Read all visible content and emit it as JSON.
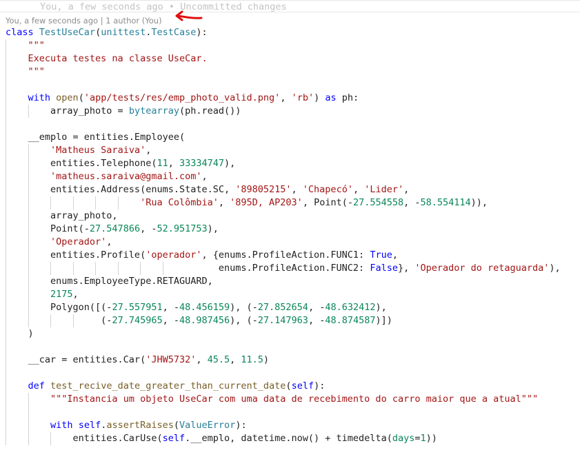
{
  "blame_ghost": "You, a few seconds ago • Uncommitted changes",
  "codelens": "You, a few seconds ago | 1 author (You)",
  "lines": [
    {
      "guides": [],
      "tokens": [
        [
          "kw",
          "class"
        ],
        [
          "t",
          " "
        ],
        [
          "cls",
          "TestUseCar"
        ],
        [
          "t",
          "("
        ],
        [
          "cls",
          "unittest"
        ],
        [
          "t",
          "."
        ],
        [
          "cls",
          "TestCase"
        ],
        [
          "t",
          "):"
        ]
      ]
    },
    {
      "guides": [
        0
      ],
      "tokens": [
        [
          "t",
          "    "
        ],
        [
          "str",
          "\"\"\""
        ]
      ]
    },
    {
      "guides": [
        0
      ],
      "tokens": [
        [
          "t",
          "    "
        ],
        [
          "str",
          "Executa testes na classe UseCar."
        ]
      ]
    },
    {
      "guides": [
        0
      ],
      "tokens": [
        [
          "t",
          "    "
        ],
        [
          "str",
          "\"\"\""
        ]
      ]
    },
    {
      "guides": [
        0
      ],
      "tokens": []
    },
    {
      "guides": [
        0
      ],
      "tokens": [
        [
          "t",
          "    "
        ],
        [
          "kw",
          "with"
        ],
        [
          "t",
          " "
        ],
        [
          "fn",
          "open"
        ],
        [
          "t",
          "("
        ],
        [
          "str",
          "'app/tests/res/emp_photo_valid.png'"
        ],
        [
          "t",
          ", "
        ],
        [
          "str",
          "'rb'"
        ],
        [
          "t",
          ") "
        ],
        [
          "kw",
          "as"
        ],
        [
          "t",
          " ph:"
        ]
      ]
    },
    {
      "guides": [
        0,
        4
      ],
      "tokens": [
        [
          "t",
          "        array_photo = "
        ],
        [
          "cls",
          "bytearray"
        ],
        [
          "t",
          "(ph.read())"
        ]
      ]
    },
    {
      "guides": [
        0
      ],
      "tokens": []
    },
    {
      "guides": [
        0
      ],
      "tokens": [
        [
          "t",
          "    __emplo = entities.Employee("
        ]
      ]
    },
    {
      "guides": [
        0,
        4
      ],
      "tokens": [
        [
          "t",
          "        "
        ],
        [
          "str",
          "'Matheus Saraiva'"
        ],
        [
          "t",
          ","
        ]
      ]
    },
    {
      "guides": [
        0,
        4
      ],
      "tokens": [
        [
          "t",
          "        entities.Telephone("
        ],
        [
          "num",
          "11"
        ],
        [
          "t",
          ", "
        ],
        [
          "num",
          "33334747"
        ],
        [
          "t",
          "),"
        ]
      ]
    },
    {
      "guides": [
        0,
        4
      ],
      "tokens": [
        [
          "t",
          "        "
        ],
        [
          "str",
          "'matheus.saraiva@gmail.com'"
        ],
        [
          "t",
          ","
        ]
      ]
    },
    {
      "guides": [
        0,
        4
      ],
      "tokens": [
        [
          "t",
          "        entities.Address(enums.State.SC, "
        ],
        [
          "str",
          "'89805215'"
        ],
        [
          "t",
          ", "
        ],
        [
          "str",
          "'Chapecó'"
        ],
        [
          "t",
          ", "
        ],
        [
          "str",
          "'Lider'"
        ],
        [
          "t",
          ","
        ]
      ]
    },
    {
      "guides": [
        0,
        4,
        8,
        12,
        16,
        20
      ],
      "tokens": [
        [
          "t",
          "                        "
        ],
        [
          "str",
          "'Rua Colômbia'"
        ],
        [
          "t",
          ", "
        ],
        [
          "str",
          "'895D, AP203'"
        ],
        [
          "t",
          ", Point(-"
        ],
        [
          "num",
          "27.554558"
        ],
        [
          "t",
          ", -"
        ],
        [
          "num",
          "58.554114"
        ],
        [
          "t",
          ")),"
        ]
      ]
    },
    {
      "guides": [
        0,
        4
      ],
      "tokens": [
        [
          "t",
          "        array_photo,"
        ]
      ]
    },
    {
      "guides": [
        0,
        4
      ],
      "tokens": [
        [
          "t",
          "        Point(-"
        ],
        [
          "num",
          "27.547866"
        ],
        [
          "t",
          ", -"
        ],
        [
          "num",
          "52.951753"
        ],
        [
          "t",
          "),"
        ]
      ]
    },
    {
      "guides": [
        0,
        4
      ],
      "tokens": [
        [
          "t",
          "        "
        ],
        [
          "str",
          "'Operador'"
        ],
        [
          "t",
          ","
        ]
      ]
    },
    {
      "guides": [
        0,
        4
      ],
      "tokens": [
        [
          "t",
          "        entities.Profile("
        ],
        [
          "str",
          "'operador'"
        ],
        [
          "t",
          ", {enums.ProfileAction.FUNC1: "
        ],
        [
          "kw",
          "True"
        ],
        [
          "t",
          ","
        ]
      ]
    },
    {
      "guides": [
        0,
        4,
        8,
        12,
        16,
        20,
        24,
        28
      ],
      "tokens": [
        [
          "t",
          "                                      enums.ProfileAction.FUNC2: "
        ],
        [
          "kw",
          "False"
        ],
        [
          "t",
          "}, "
        ],
        [
          "str",
          "'Operador do retaguarda'"
        ],
        [
          "t",
          "),"
        ]
      ]
    },
    {
      "guides": [
        0,
        4
      ],
      "tokens": [
        [
          "t",
          "        enums.EmployeeType.RETAGUARD,"
        ]
      ]
    },
    {
      "guides": [
        0,
        4
      ],
      "tokens": [
        [
          "t",
          "        "
        ],
        [
          "num",
          "2175"
        ],
        [
          "t",
          ","
        ]
      ]
    },
    {
      "guides": [
        0,
        4
      ],
      "tokens": [
        [
          "t",
          "        Polygon([(-"
        ],
        [
          "num",
          "27.557951"
        ],
        [
          "t",
          ", -"
        ],
        [
          "num",
          "48.456159"
        ],
        [
          "t",
          "), (-"
        ],
        [
          "num",
          "27.852654"
        ],
        [
          "t",
          ", -"
        ],
        [
          "num",
          "48.632412"
        ],
        [
          "t",
          "),"
        ]
      ]
    },
    {
      "guides": [
        0,
        4,
        8,
        12
      ],
      "tokens": [
        [
          "t",
          "                 (-"
        ],
        [
          "num",
          "27.745965"
        ],
        [
          "t",
          ", -"
        ],
        [
          "num",
          "48.987456"
        ],
        [
          "t",
          "), (-"
        ],
        [
          "num",
          "27.147963"
        ],
        [
          "t",
          ", -"
        ],
        [
          "num",
          "48.874587"
        ],
        [
          "t",
          ")])"
        ]
      ]
    },
    {
      "guides": [
        0
      ],
      "tokens": [
        [
          "t",
          "    )"
        ]
      ]
    },
    {
      "guides": [
        0
      ],
      "tokens": []
    },
    {
      "guides": [
        0
      ],
      "tokens": [
        [
          "t",
          "    __car = entities.Car("
        ],
        [
          "str",
          "'JHW5732'"
        ],
        [
          "t",
          ", "
        ],
        [
          "num",
          "45.5"
        ],
        [
          "t",
          ", "
        ],
        [
          "num",
          "11.5"
        ],
        [
          "t",
          ")"
        ]
      ]
    },
    {
      "guides": [
        0
      ],
      "tokens": []
    },
    {
      "guides": [
        0
      ],
      "tokens": [
        [
          "t",
          "    "
        ],
        [
          "kw",
          "def"
        ],
        [
          "t",
          " "
        ],
        [
          "fn",
          "test_recive_date_greater_than_current_date"
        ],
        [
          "t",
          "("
        ],
        [
          "self",
          "self"
        ],
        [
          "t",
          "):"
        ]
      ]
    },
    {
      "guides": [
        0,
        4
      ],
      "tokens": [
        [
          "t",
          "        "
        ],
        [
          "str",
          "\"\"\"Instancia um objeto UseCar com uma data de recebimento do carro maior que a atual\"\"\""
        ]
      ]
    },
    {
      "guides": [
        0,
        4
      ],
      "tokens": []
    },
    {
      "guides": [
        0,
        4
      ],
      "tokens": [
        [
          "t",
          "        "
        ],
        [
          "kw",
          "with"
        ],
        [
          "t",
          " "
        ],
        [
          "self",
          "self"
        ],
        [
          "t",
          "."
        ],
        [
          "fn",
          "assertRaises"
        ],
        [
          "t",
          "("
        ],
        [
          "cls",
          "ValueError"
        ],
        [
          "t",
          "):"
        ]
      ]
    },
    {
      "guides": [
        0,
        4,
        8
      ],
      "tokens": [
        [
          "t",
          "            entities.CarUse("
        ],
        [
          "self",
          "self"
        ],
        [
          "t",
          ".__emplo, datetime.now() + timedelta("
        ],
        [
          "num",
          "days"
        ],
        [
          "t",
          "="
        ],
        [
          "num",
          "1"
        ],
        [
          "t",
          "))"
        ]
      ]
    }
  ]
}
